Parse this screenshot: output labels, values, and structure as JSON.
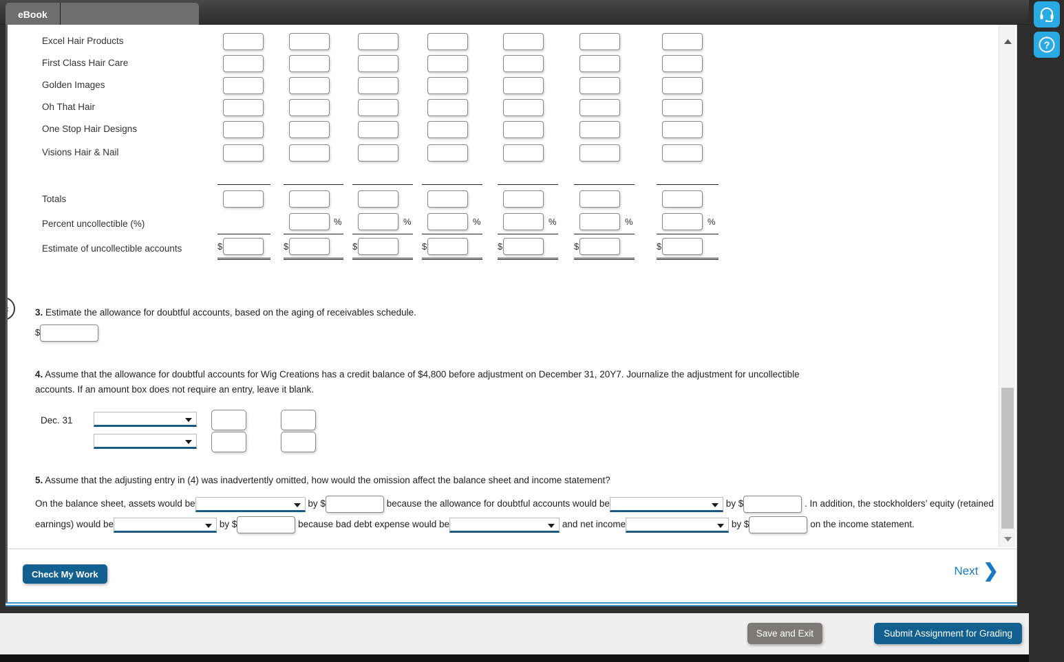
{
  "window": {
    "tabs": [
      {
        "label": "eBook",
        "active": true
      },
      {
        "label": "",
        "active": false
      }
    ]
  },
  "right_rail": {
    "support_icon": "headset-icon",
    "help_icon": "question-mark-icon"
  },
  "aging_table": {
    "rows": [
      {
        "label": "Excel Hair Products",
        "type": "entry"
      },
      {
        "label": "First Class Hair Care",
        "type": "entry"
      },
      {
        "label": "Golden Images",
        "type": "entry"
      },
      {
        "label": "Oh That Hair",
        "type": "entry"
      },
      {
        "label": "One Stop Hair Designs",
        "type": "entry"
      },
      {
        "label": "Visions Hair & Nail",
        "type": "entry"
      },
      {
        "label": "Totals",
        "type": "totals"
      },
      {
        "label": "Percent uncollectible (%)",
        "type": "percent"
      },
      {
        "label": "Estimate of uncollectible accounts",
        "type": "estimate"
      }
    ],
    "column_count": 7,
    "percent_symbol": "%",
    "currency_symbol": "$",
    "cell_value": ""
  },
  "question3": {
    "number": "3.",
    "text": "Estimate the allowance for doubtful accounts, based on the aging of receivables schedule.",
    "currency_symbol": "$",
    "answer_value": ""
  },
  "question4": {
    "number": "4.",
    "line1": "Assume that the allowance for doubtful accounts for Wig Creations has a credit balance of $4,800 before adjustment on December 31, 20Y7. Journalize the adjustment for uncollectible",
    "line2": "accounts. If an amount box does not require an entry, leave it blank.",
    "date_label": "Dec. 31",
    "account_select_1": "",
    "account_select_2": "",
    "debit_1": "",
    "credit_1": "",
    "debit_2": "",
    "credit_2": ""
  },
  "question5": {
    "number": "5.",
    "text": "Assume that the adjusting entry in (4) was inadvertently omitted, how would the omission affect the balance sheet and income statement?",
    "seg1": "On the balance sheet, assets would be",
    "seg2": "by $",
    "seg3": "because the allowance for doubtful accounts would be",
    "seg4": "by $",
    "seg5": ". In addition, the",
    "seg6": "stockholders’ equity (retained earnings) would be",
    "seg7": "by $",
    "seg8": "because bad debt expense would be",
    "seg9": "and net income",
    "seg10": "by $",
    "seg11": "on the income statement.",
    "select_assets": "",
    "amount_assets": "",
    "select_allowance": "",
    "amount_allowance": "",
    "select_equity": "",
    "amount_equity": "",
    "select_baddebt": "",
    "select_netincome": "",
    "amount_netincome": ""
  },
  "footer": {
    "check_my_work": "Check My Work",
    "next": "Next",
    "next_icon": "chevron-right-icon"
  },
  "bottom_bar": {
    "save_and_exit": "Save and Exit",
    "submit_assignment": "Submit Assignment for Grading"
  },
  "colors": {
    "accent_blue": "#11608f",
    "link_blue": "#1b78c2",
    "rail_blue": "#29aae2",
    "underline_blue": "#1a5b86",
    "gray_button": "#7d7a76"
  }
}
